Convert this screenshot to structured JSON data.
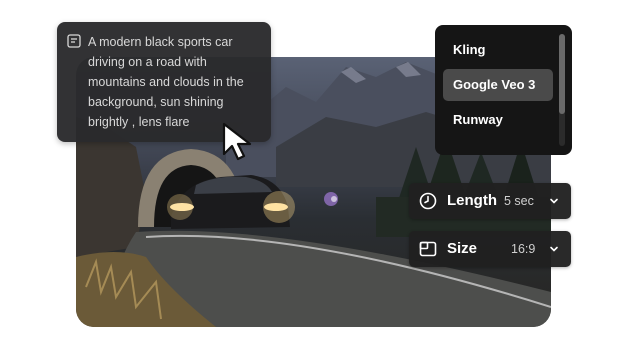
{
  "prompt": {
    "text": "A modern black sports car driving on a road with mountains and clouds in the background, sun shining brightly , lens flare",
    "icon": "text-prompt-icon"
  },
  "models": {
    "items": [
      {
        "label": "Kling",
        "selected": false
      },
      {
        "label": "Google Veo 3",
        "selected": true
      },
      {
        "label": "Runway",
        "selected": false
      }
    ]
  },
  "settings": {
    "length": {
      "label": "Length",
      "value": "5 sec",
      "icon": "clock-icon"
    },
    "size": {
      "label": "Size",
      "value": "16:9",
      "icon": "aspect-ratio-icon"
    }
  },
  "scene": {
    "description_icon": "video-preview"
  }
}
